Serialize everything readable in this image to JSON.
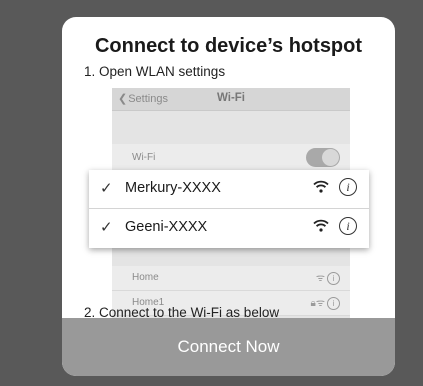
{
  "dialog": {
    "title": "Connect to device’s hotspot",
    "step1": "1. Open WLAN settings",
    "step2": "2. Connect to the Wi-Fi as below",
    "button": "Connect Now"
  },
  "phone": {
    "back_label": "Settings",
    "title": "Wi-Fi",
    "wifi_label": "Wi-Fi",
    "networks": [
      {
        "name": "Home"
      },
      {
        "name": "Home1"
      }
    ]
  },
  "popup": {
    "items": [
      {
        "check": "✓",
        "ssid": "Merkury-XXXX"
      },
      {
        "check": "✓",
        "ssid": "Geeni-XXXX"
      }
    ]
  },
  "icons": {
    "wifi": "wifi-icon",
    "info": "info-icon",
    "lock": "lock-icon",
    "check": "checkmark-icon",
    "back": "chevron-left-icon"
  },
  "colors": {
    "backdrop": "#595959",
    "card": "#ffffff",
    "button": "#999999"
  }
}
